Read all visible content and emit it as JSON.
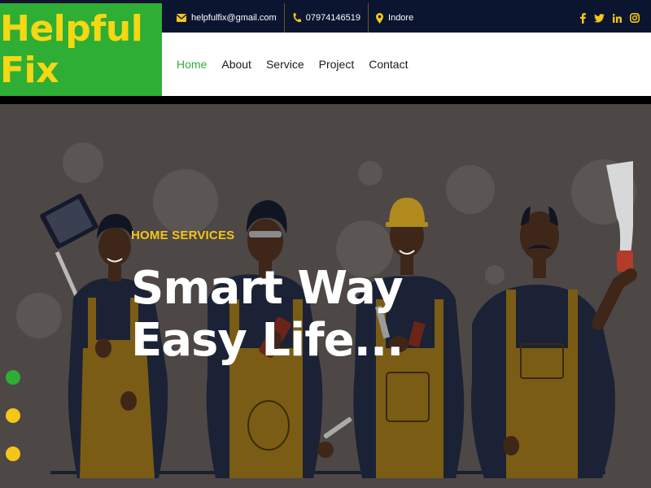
{
  "brand": {
    "logo_text": "Helpful Fix",
    "green": "#2eae35",
    "yellow": "#f5c518",
    "navy": "#0b1530"
  },
  "topbar": {
    "email": "helpfulfix@gmail.com",
    "phone": "07974146519",
    "location": "Indore",
    "icons": [
      "envelope-icon",
      "phone-icon",
      "map-pin-icon"
    ],
    "socials": [
      {
        "name": "facebook-icon",
        "glyph": "f"
      },
      {
        "name": "twitter-icon",
        "glyph": "t"
      },
      {
        "name": "linkedin-icon",
        "glyph": "in"
      },
      {
        "name": "instagram-icon",
        "glyph": "ig"
      }
    ]
  },
  "nav": {
    "items": [
      {
        "label": "Home",
        "active": true
      },
      {
        "label": "About",
        "active": false
      },
      {
        "label": "Service",
        "active": false
      },
      {
        "label": "Project",
        "active": false
      },
      {
        "label": "Contact",
        "active": false
      }
    ]
  },
  "hero": {
    "subtitle": "HOME SERVICES",
    "title": "Smart Way Easy Life...",
    "slider_dots": [
      {
        "state": "active",
        "color": "#2eae35"
      },
      {
        "state": "inactive",
        "color": "#f5c518"
      },
      {
        "state": "inactive",
        "color": "#f5c518"
      }
    ]
  }
}
